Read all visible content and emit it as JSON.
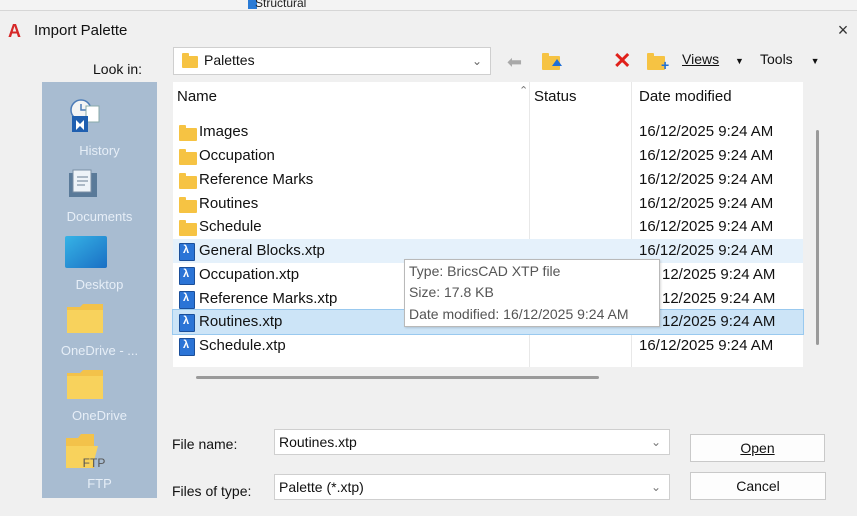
{
  "background": {
    "fragment": "Structural"
  },
  "dialog": {
    "title": "Import Palette",
    "app_icon_letter": "A",
    "close_glyph": "×"
  },
  "toolbar": {
    "look_in_label": "Look in:",
    "look_in_value": "Palettes",
    "views_label": "Views",
    "tools_label": "Tools",
    "icons": [
      "back-arrow-icon",
      "up-folder-icon",
      "delete-icon",
      "new-folder-icon"
    ]
  },
  "places": [
    {
      "label": "History",
      "icon": "history-icon"
    },
    {
      "label": "Documents",
      "icon": "documents-icon"
    },
    {
      "label": "Desktop",
      "icon": "desktop-icon"
    },
    {
      "label": "OneDrive - ...",
      "icon": "folder-icon"
    },
    {
      "label": "OneDrive",
      "icon": "folder-icon"
    },
    {
      "label": "FTP",
      "icon": "ftp-folder-icon",
      "overlay": "FTP"
    }
  ],
  "columns": {
    "name": "Name",
    "status": "Status",
    "date": "Date modified"
  },
  "files": [
    {
      "name": "Images",
      "type": "folder",
      "date": "16/12/2025 9:24 AM"
    },
    {
      "name": "Occupation",
      "type": "folder",
      "date": "16/12/2025 9:24 AM"
    },
    {
      "name": "Reference Marks",
      "type": "folder",
      "date": "16/12/2025 9:24 AM"
    },
    {
      "name": "Routines",
      "type": "folder",
      "date": "16/12/2025 9:24 AM"
    },
    {
      "name": "Schedule",
      "type": "folder",
      "date": "16/12/2025 9:24 AM"
    },
    {
      "name": "General Blocks.xtp",
      "type": "xtp",
      "date": "16/12/2025 9:24 AM",
      "state": "hover"
    },
    {
      "name": "Occupation.xtp",
      "type": "xtp",
      "date": "12/2025 9:24 AM"
    },
    {
      "name": "Reference Marks.xtp",
      "type": "xtp",
      "date": "12/2025 9:24 AM"
    },
    {
      "name": "Routines.xtp",
      "type": "xtp",
      "date": "12/2025 9:24 AM",
      "state": "selected"
    },
    {
      "name": "Schedule.xtp",
      "type": "xtp",
      "date": "16/12/2025 9:24 AM"
    }
  ],
  "tooltip": {
    "type": "Type: BricsCAD XTP file",
    "size": "Size: 17.8 KB",
    "modified": "Date modified: 16/12/2025 9:24 AM"
  },
  "form": {
    "file_name_label": "File name:",
    "file_name_value": "Routines.xtp",
    "file_type_label": "Files of type:",
    "file_type_value": "Palette (*.xtp)",
    "open_label": "Open",
    "cancel_label": "Cancel"
  },
  "colors": {
    "places_bg": "#a8bcd1",
    "selection": "#cce4f7",
    "hover": "#e5f1fb",
    "folder": "#f6c343",
    "delete": "#e0201a",
    "xtp_icon": "#2b74d6"
  }
}
